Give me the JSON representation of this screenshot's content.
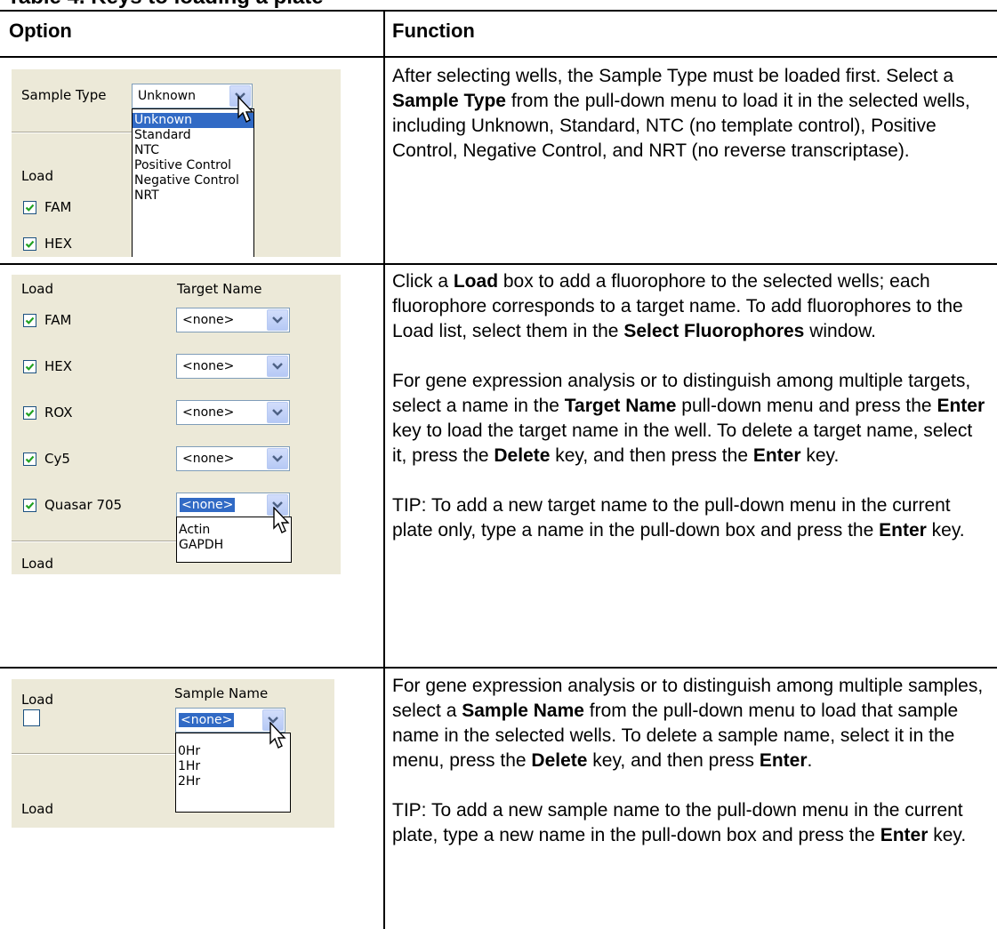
{
  "caption": "Table 4. Keys to loading a plate",
  "table": {
    "col_option": "Option",
    "col_function": "Function"
  },
  "row1": {
    "shot": {
      "sample_type_label": "Sample Type",
      "combo_value": "Unknown",
      "load_label": "Load",
      "fluors": [
        "FAM",
        "HEX"
      ],
      "dropdown_items": [
        "Unknown",
        "Standard",
        "NTC",
        "Positive Control",
        "Negative Control",
        "NRT"
      ]
    },
    "text": {
      "a": "After selecting wells, the Sample Type must be loaded first. Select a ",
      "b": "Sample Type",
      "c": " from the pull-down menu to load it in the selected wells, including Unknown, Standard, NTC (no template control), Positive Control, Negative Control, and NRT (no reverse transcriptase)."
    }
  },
  "row2": {
    "shot": {
      "load_label": "Load",
      "target_name_label": "Target Name",
      "fluors": [
        "FAM",
        "HEX",
        "ROX",
        "Cy5",
        "Quasar 705"
      ],
      "combo_value": "<none>",
      "dropdown_items": [
        "Actin",
        "GAPDH"
      ],
      "bottom_load_label": "Load"
    },
    "p1": {
      "a": "Click a ",
      "b": "Load",
      "c": " box to add a fluorophore to the selected wells; each fluorophore corresponds to a target name. To add fluorophores to the Load list, select them in the ",
      "d": "Select Fluorophores",
      "e": " window."
    },
    "p2": {
      "a": "For gene expression analysis or to distinguish among multiple targets, select a name in the ",
      "b": "Target Name",
      "c": " pull-down menu and press the ",
      "d": "Enter",
      "e": " key to load the target name in the well. To delete a target name, select it, press the ",
      "f": "Delete",
      "g": " key, and then press the ",
      "h": "Enter",
      "i": " key."
    },
    "p3": {
      "a": "TIP: To add a new target name to the pull-down menu in the current plate only, type a name in the pull-down box and press the ",
      "b": "Enter",
      "c": " key."
    }
  },
  "row3": {
    "shot": {
      "load_label": "Load",
      "sample_name_label": "Sample Name",
      "combo_value": "<none>",
      "dropdown_items": [
        "0Hr",
        "1Hr",
        "2Hr"
      ],
      "bottom_load_label": "Load"
    },
    "p1": {
      "a": "For gene expression analysis or to distinguish among multiple samples, select a ",
      "b": "Sample Name",
      "c": " from the pull-down menu to load that sample name in the selected wells. To delete a sample name, select it in the menu, press the ",
      "d": "Delete",
      "e": " key, and then press ",
      "f": "Enter",
      "g": "."
    },
    "p2": {
      "a": "TIP: To add a new sample name to the pull-down menu in the current plate, type a new name in the pull-down box and press the ",
      "b": "Enter",
      "c": " key."
    }
  },
  "colors": {
    "panel_bg": "#ece9d8",
    "selection": "#316ac5",
    "combo_border": "#7f9db9",
    "check_green": "#21a121"
  },
  "icons": [
    "dropdown-arrow-icon",
    "checkmark-icon",
    "mouse-pointer-icon"
  ]
}
